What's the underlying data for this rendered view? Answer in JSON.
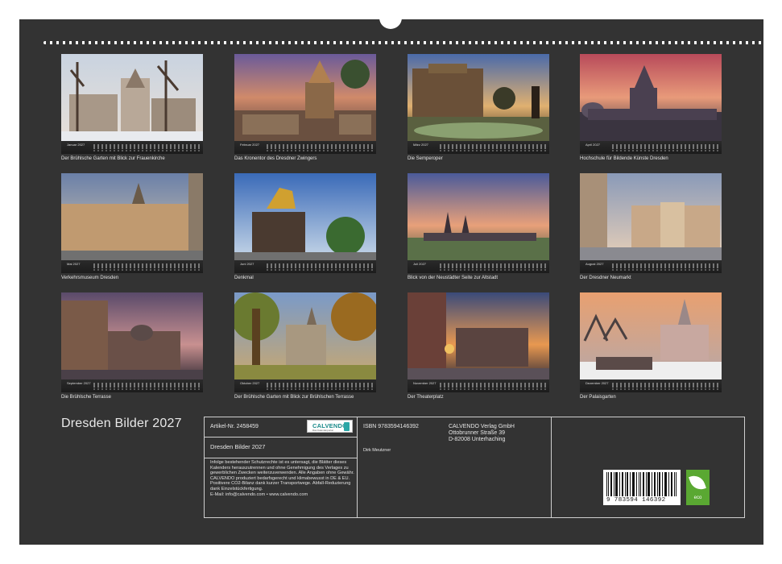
{
  "calendar_title": "Dresden Bilder 2027",
  "months": [
    {
      "name": "Januar 2027",
      "caption": "Der Brühlsche Garten mit Blick zur Frauenkirche"
    },
    {
      "name": "Februar 2027",
      "caption": "Das Kronentor des Dresdner Zwingers"
    },
    {
      "name": "März 2027",
      "caption": "Die Semperoper"
    },
    {
      "name": "April 2027",
      "caption": "Hochschule für Bildende Künste Dresden"
    },
    {
      "name": "Mai 2027",
      "caption": "Verkehrsmuseum Dresden"
    },
    {
      "name": "Juni 2027",
      "caption": "Denkmal"
    },
    {
      "name": "Juli 2027",
      "caption": "Blick von der Neustädter Seite zur Altstadt"
    },
    {
      "name": "August 2027",
      "caption": "Der Dresdner Neumarkt"
    },
    {
      "name": "September 2027",
      "caption": "Die Brühlsche Terrasse"
    },
    {
      "name": "Oktober 2027",
      "caption": "Der Brühlsche Garten mit Blick zur Brühlschen Terrasse"
    },
    {
      "name": "November 2027",
      "caption": "Der Theaterplatz"
    },
    {
      "name": "Dezember 2027",
      "caption": "Der Palaisgarten"
    }
  ],
  "info": {
    "article_number": "Artikel-Nr. 2458459",
    "logo_name": "CALVENDO",
    "logo_sub": "Das Kalenderportal",
    "title": "Dresden Bilder 2027",
    "legal_text": "Infolge bestehender Schutzrechte ist es untersagt, die Blätter dieses Kalenders herauszutrennen und ohne Genehmigung des Verlages zu gewerblichen Zwecken weiterzuverwenden. Alle Angaben ohne Gewähr. CALVENDO produziert bedarfsgerecht und klimabewusst in DE & EU. Positivere CO2-Bilanz dank kurzer Transportwege. Abfall-Reduzierung dank Einzelstückfertigung.",
    "email_line": "E-Mail: info@calvendo.com • www.calvendo.com",
    "isbn": "ISBN 9783594146392",
    "author": "Dirk Meutzner",
    "publisher_name": "CALVENDO Verlag GmbH",
    "publisher_street": "Ottobrunner Straße 39",
    "publisher_city": "D-82008 Unterhaching",
    "barcode_number": "9 783594 146392",
    "eco_label": "eco"
  }
}
